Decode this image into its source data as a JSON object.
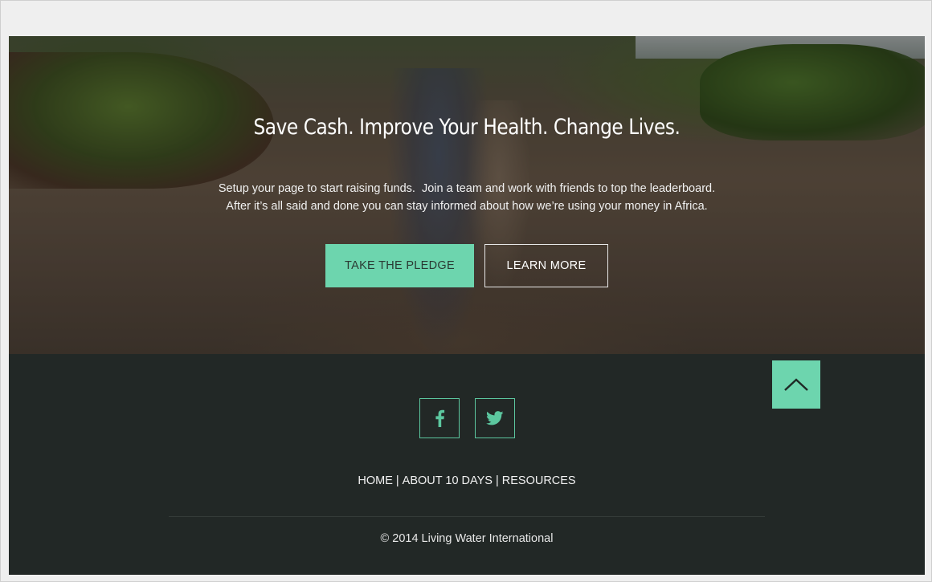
{
  "hero": {
    "title": "Save Cash. Improve Your Health. Change Lives.",
    "subtitle_line1": "Setup your page to start raising funds.  Join a team and work with friends to top the leaderboard.",
    "subtitle_line2": "After it’s all said and done you can stay informed about how we’re using your money in Africa.",
    "pledge_label": "TAKE THE PLEDGE",
    "learn_label": "LEARN MORE"
  },
  "footer": {
    "social": [
      {
        "icon": "facebook-icon"
      },
      {
        "icon": "twitter-icon"
      }
    ],
    "nav": {
      "home": "HOME",
      "about": "ABOUT 10 DAYS",
      "resources": "RESOURCES",
      "separator": "|"
    },
    "copyright": "© 2014 Living Water International",
    "back_to_top_icon": "chevron-up-icon"
  },
  "colors": {
    "accent": "#6dd5ae",
    "footer_bg": "#222826"
  }
}
